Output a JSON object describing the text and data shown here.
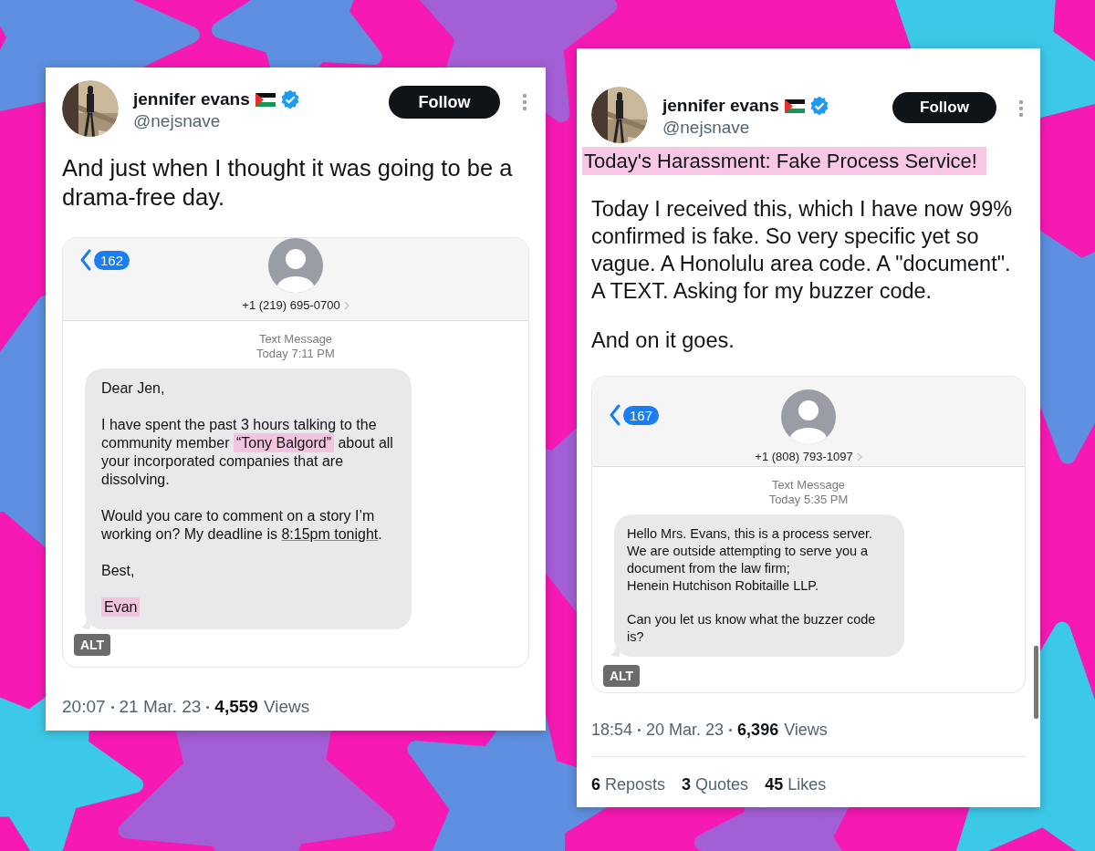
{
  "posts": [
    {
      "author": {
        "name": "jennifer evans",
        "handle": "@nejsnave",
        "verified": true
      },
      "follow_button": "Follow",
      "text": [
        {
          "text": "And just when I thought it was going to be a drama-free day.",
          "highlighted": false
        }
      ],
      "media": {
        "badge": "162",
        "phone": "+1 (219) 695-0700",
        "header": "Text Message",
        "time": "Today 7:11 PM",
        "message": [
          [
            [
              {
                "text": "Dear Jen,"
              }
            ]
          ],
          [
            [
              {
                "text": "I have spent the past 3 hours talking to the community member "
              },
              {
                "text": "“Tony Balgord”",
                "highlighted": true
              },
              {
                "text": " about all your incorporated companies that are dissolving."
              }
            ]
          ],
          [
            [
              {
                "text": "Would you care to comment on a story I’m working on? My deadline is "
              },
              {
                "text": "8:15pm tonight",
                "underlined": true
              },
              {
                "text": "."
              }
            ]
          ],
          [
            [
              {
                "text": "Best,"
              }
            ]
          ],
          [
            [
              {
                "text": "Evan",
                "highlighted": true
              }
            ]
          ]
        ],
        "alt": "ALT"
      },
      "meta": {
        "time": "20:07",
        "date": "21 Mar. 23",
        "views_count": "4,559",
        "views_label": "Views"
      }
    },
    {
      "author": {
        "name": "jennifer evans",
        "handle": "@nejsnave",
        "verified": true
      },
      "follow_button": "Follow",
      "text": [
        {
          "text": "Today's Harassment: Fake Process Service!",
          "highlighted": true
        },
        {
          "text": "Today I received this, which I have now 99% confirmed is fake. So very specific yet so vague. A Honolulu area code. A \"document\". A TEXT. Asking for my buzzer code.",
          "highlighted": false
        },
        {
          "text": "And on it goes.",
          "highlighted": false
        }
      ],
      "media": {
        "badge": "167",
        "phone": "+1 (808) 793-1097",
        "header": "Text Message",
        "time": "Today 5:35 PM",
        "message": [
          [
            [
              {
                "text": "Hello Mrs. Evans, this is a process server. We are outside attempting to serve you a document from the law firm;"
              }
            ],
            [
              {
                "text": "Henein Hutchison Robitaille LLP."
              }
            ]
          ],
          [
            [
              {
                "text": "Can you let us know what the buzzer code is?"
              }
            ]
          ]
        ],
        "alt": "ALT"
      },
      "meta": {
        "time": "18:54",
        "date": "20 Mar. 23",
        "views_count": "6,396",
        "views_label": "Views"
      },
      "stats": [
        {
          "count": "6",
          "label": "Reposts"
        },
        {
          "count": "3",
          "label": "Quotes"
        },
        {
          "count": "45",
          "label": "Likes"
        }
      ]
    }
  ]
}
